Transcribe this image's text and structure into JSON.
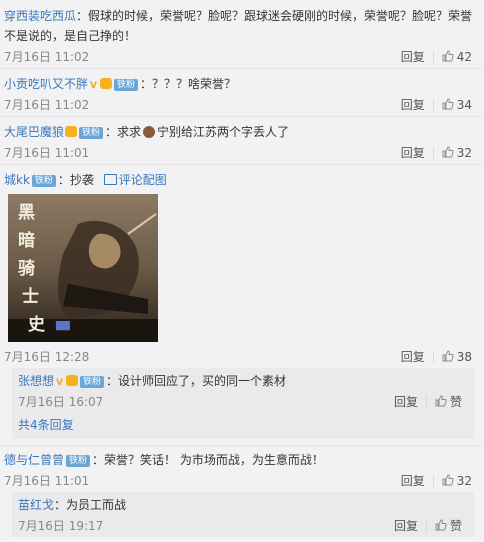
{
  "comments": [
    {
      "user": "穿西装吃西瓜",
      "text": "：假球的时候，荣誉呢？脸呢？跟球迷会硬刚的时候，荣誉呢？脸呢？荣誉不是说的，是自己挣的！",
      "time": "7月16日 11:02",
      "reply": "回复",
      "likes": "42"
    },
    {
      "user": "小贡吃叭又不胖",
      "badge": "铁粉",
      "text": "：？？？啥荣誉？",
      "time": "7月16日 11:02",
      "reply": "回复",
      "likes": "34"
    },
    {
      "user": "大尾巴魔狼",
      "badge": "铁粉",
      "text_a": "：求求",
      "text_b": "宁别给江苏两个字丢人了",
      "time": "7月16日 11:01",
      "reply": "回复",
      "likes": "32"
    },
    {
      "user": "城kk",
      "badge": "铁粉",
      "text": "：抄袭",
      "link": "评论配图",
      "image_text": "黑暗骑士史",
      "time": "7月16日 12:28",
      "reply": "回复",
      "likes": "38",
      "sub": {
        "user": "张想想",
        "badge": "铁粉",
        "text": "：设计师回应了，买的同一个素材",
        "time": "7月16日 16:07",
        "reply": "回复",
        "like_label": "赞",
        "more": "共4条回复"
      }
    },
    {
      "user": "德与仁曾曾",
      "badge": "铁粉",
      "text": "：荣誉？笑话！ 为市场而战，为生意而战！",
      "time": "7月16日 11:01",
      "reply": "回复",
      "likes": "32",
      "sub": {
        "user": "苗红戈",
        "text": "：为员工而战",
        "time": "7月16日 19:17",
        "reply": "回复",
        "like_label": "赞"
      }
    }
  ],
  "colors": {
    "link": "#3a77b8",
    "username_orange": "#eb7350",
    "badge": "#6aa6d8"
  },
  "icons": [
    "thumb-up-icon",
    "vip-v-icon",
    "crown-icon",
    "image-icon"
  ]
}
